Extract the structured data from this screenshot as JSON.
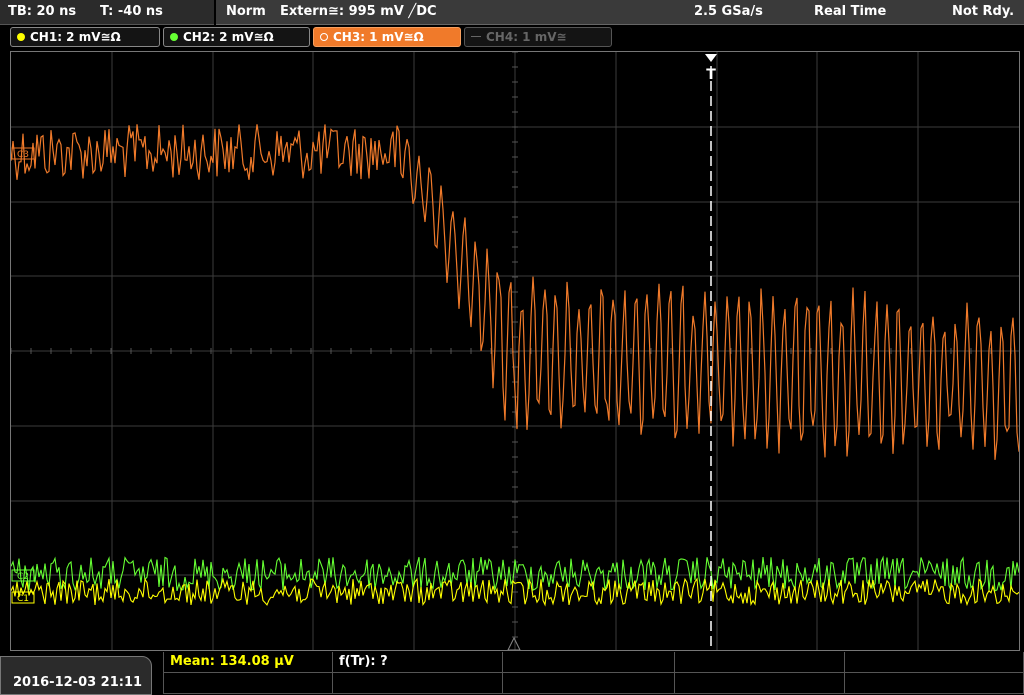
{
  "topbar": {
    "timebase": "TB: 20 ns",
    "trigger_offset": "T: -40 ns",
    "mode": "Norm",
    "trigger_source": "Extern≅: 995 mV ╱DC",
    "sample_rate": "2.5 GSa/s",
    "acq_mode": "Real Time",
    "status": "Not Rdy."
  },
  "channels": [
    {
      "label": "CH1: 2 mV≅Ω",
      "color": "#ffff00",
      "state": "on"
    },
    {
      "label": "CH2: 2 mV≅Ω",
      "color": "#66ff33",
      "state": "on"
    },
    {
      "label": "CH3: 1 mV≅Ω",
      "color": "#f07a2a",
      "state": "active"
    },
    {
      "label": "CH4: 1 mV≅",
      "color": "#666666",
      "state": "off"
    }
  ],
  "markers": {
    "ch3_marker": "C3",
    "ch2_marker": "C2",
    "ch1_marker": "C1",
    "trigger_marker": "T"
  },
  "measurement": {
    "mean": "Mean: 134.08 µV",
    "rise": "f(Tr): ?"
  },
  "datetime": "2016-12-03 21:11",
  "colors": {
    "ch1": "#ffff00",
    "ch2": "#66ff33",
    "ch3": "#f07a2a",
    "grid": "#3c3c3c",
    "trigger_line": "#ffffff"
  }
}
